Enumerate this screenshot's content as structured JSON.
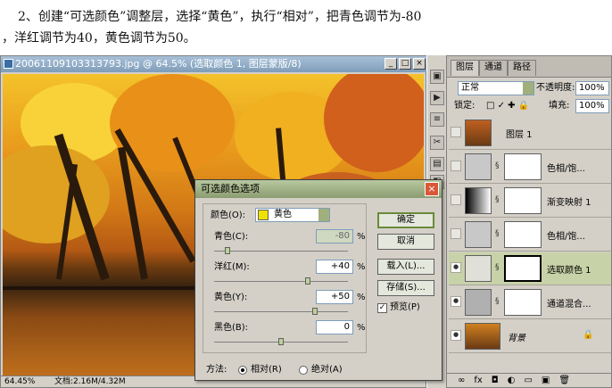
{
  "instruction": {
    "line1": "2、创建“可选颜色”调整层，选择“黄色”，执行“相对”，把青色调节为-80",
    "line2": "，洋红调节为40，黄色调节为50。"
  },
  "document": {
    "title": "20061109103313793.jpg @ 64.5% (选取颜色 1, 图层蒙版/8)",
    "zoom": "64.45%",
    "doc_size": "文档:2.16M/4.32M"
  },
  "layers_panel": {
    "tabs": [
      "图层",
      "通道",
      "路径"
    ],
    "blend_mode": "正常",
    "opacity_label": "不透明度:",
    "opacity": "100%",
    "lock_label": "锁定:",
    "fill_label": "填充:",
    "fill": "100%",
    "layers": [
      {
        "name": "图层 1"
      },
      {
        "name": "色相/饱..."
      },
      {
        "name": "渐变映射 1"
      },
      {
        "name": "色相/饱..."
      },
      {
        "name": "选取颜色 1"
      },
      {
        "name": "通道混合..."
      },
      {
        "name": "背景"
      }
    ]
  },
  "dialog": {
    "title": "可选颜色选项",
    "colors_label": "颜色(O):",
    "colors_value": "黄色",
    "sliders": [
      {
        "label": "青色(C):",
        "value": "-80",
        "level": 0.1
      },
      {
        "label": "洋红(M):",
        "value": "+40",
        "level": 0.7
      },
      {
        "label": "黄色(Y):",
        "value": "+50",
        "level": 0.75
      },
      {
        "label": "黑色(B):",
        "value": "0",
        "level": 0.5
      }
    ],
    "percent": "%",
    "buttons": {
      "ok": "确定",
      "cancel": "取消",
      "load": "载入(L)...",
      "save": "存储(S)..."
    },
    "preview": "预览(P)",
    "method_label": "方法:",
    "relative": "相对(R)",
    "absolute": "绝对(A)"
  },
  "colors": {
    "accent": "#8a9c70",
    "close": "#d85838",
    "swatch_yellow": "#f0e000"
  }
}
